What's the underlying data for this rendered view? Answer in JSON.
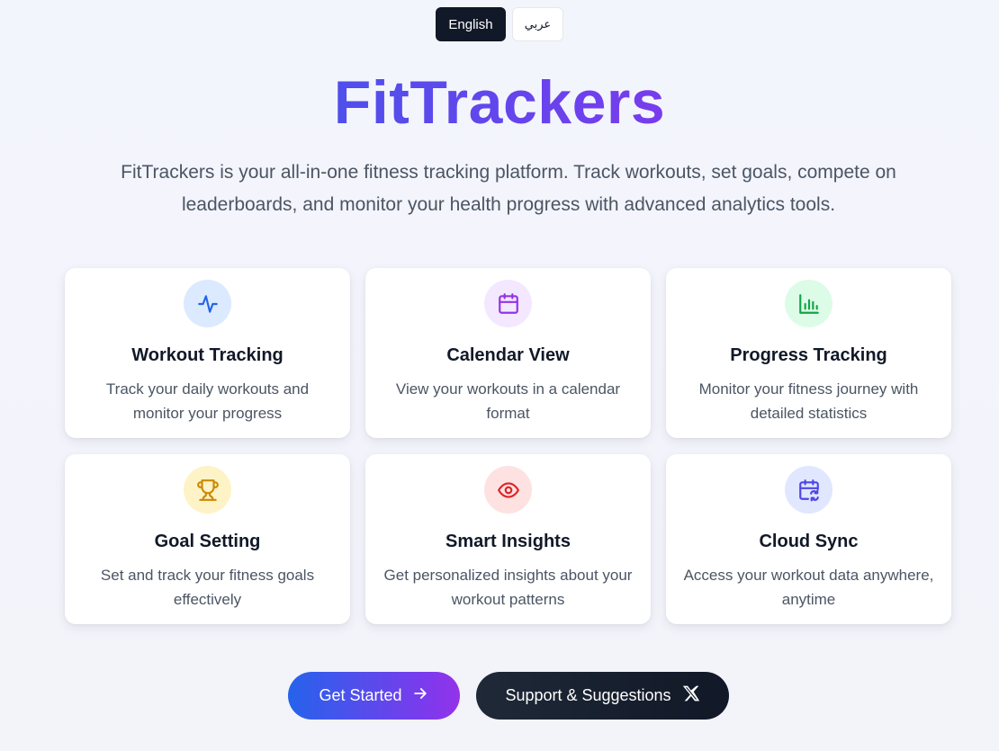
{
  "language_switch": {
    "english_label": "English",
    "arabic_label": "عربي",
    "active": "English"
  },
  "hero": {
    "title": "FitTrackers",
    "subtitle": "FitTrackers is your all-in-one fitness tracking platform. Track workouts, set goals, compete on leaderboards, and monitor your health progress with advanced analytics tools."
  },
  "features": [
    {
      "title": "Workout Tracking",
      "description": "Track your daily workouts and monitor your progress",
      "icon": "activity-icon",
      "icon_color": "#2563eb",
      "icon_bg": "#dbeafe"
    },
    {
      "title": "Calendar View",
      "description": "View your workouts in a calendar format",
      "icon": "calendar-icon",
      "icon_color": "#9333ea",
      "icon_bg": "#f3e8ff"
    },
    {
      "title": "Progress Tracking",
      "description": "Monitor your fitness journey with detailed statistics",
      "icon": "bar-chart-icon",
      "icon_color": "#16a34a",
      "icon_bg": "#dcfce7"
    },
    {
      "title": "Goal Setting",
      "description": "Set and track your fitness goals effectively",
      "icon": "trophy-icon",
      "icon_color": "#ca8a04",
      "icon_bg": "#fef3c7"
    },
    {
      "title": "Smart Insights",
      "description": "Get personalized insights about your workout patterns",
      "icon": "eye-icon",
      "icon_color": "#dc2626",
      "icon_bg": "#fee2e2"
    },
    {
      "title": "Cloud Sync",
      "description": "Access your workout data anywhere, anytime",
      "icon": "calendar-sync-icon",
      "icon_color": "#4f46e5",
      "icon_bg": "#e0e7ff"
    }
  ],
  "cta": {
    "get_started_label": "Get Started",
    "support_label": "Support & Suggestions"
  },
  "colors": {
    "brand_gradient_start": "#2563eb",
    "brand_gradient_end": "#9333ea",
    "dark": "#111827"
  }
}
